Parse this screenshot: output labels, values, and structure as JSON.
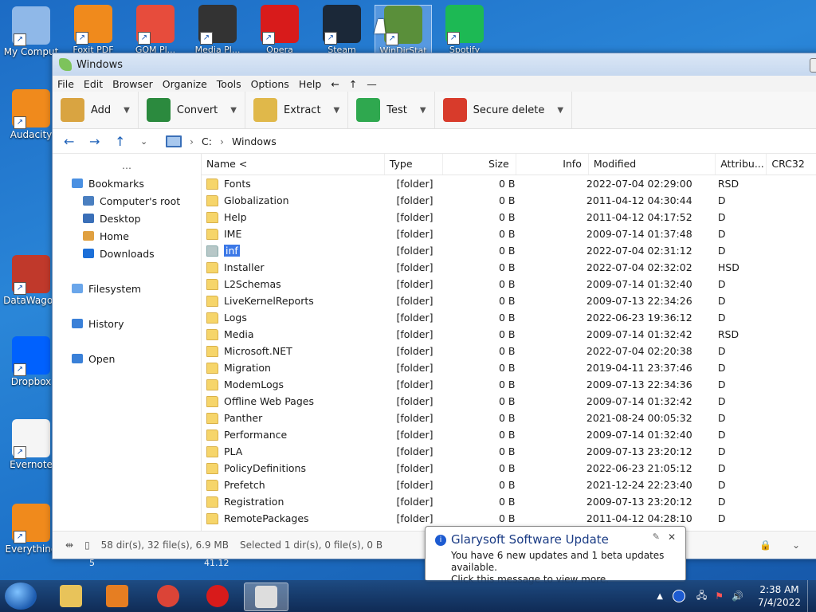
{
  "desktop": {
    "left_icons": [
      {
        "label": "My Comput",
        "color": "#8fb8e8"
      },
      {
        "label": "Audacity",
        "color": "#f08a1c"
      },
      {
        "label": "DataWagon",
        "color": "#c0392b"
      },
      {
        "label": "Dropbox",
        "color": "#0061fe"
      },
      {
        "label": "Evernote",
        "color": "#f5f5f5"
      },
      {
        "label": "Everything",
        "color": "#f08a1c"
      }
    ],
    "top_icons": [
      {
        "label": "Foxit PDF",
        "color": "#f08a1c"
      },
      {
        "label": "GOM Pl...",
        "color": "#e74c3c"
      },
      {
        "label": "Media Pl...",
        "color": "#333333"
      },
      {
        "label": "Opera",
        "color": "#d81b1b"
      },
      {
        "label": "Steam",
        "color": "#1b2838"
      },
      {
        "label": "WinDirStat",
        "color": "#5a8f3a"
      },
      {
        "label": "Spotify",
        "color": "#1db954"
      }
    ],
    "stray_texts": [
      "5",
      "41.12"
    ]
  },
  "window": {
    "title": "Windows",
    "menu": [
      "File",
      "Edit",
      "Browser",
      "Organize",
      "Tools",
      "Options",
      "Help",
      "←",
      "↑",
      "—"
    ],
    "toolbar": [
      {
        "label": "Add",
        "color": "#d9a441"
      },
      {
        "label": "Convert",
        "color": "#2b8a3e"
      },
      {
        "label": "Extract",
        "color": "#e0b84a"
      },
      {
        "label": "Test",
        "color": "#2fa84f"
      },
      {
        "label": "Secure delete",
        "color": "#d83b2b"
      }
    ],
    "address": {
      "drive": "C:",
      "folder": "Windows"
    },
    "sidebar": {
      "dots": "…",
      "items": [
        {
          "label": "Bookmarks",
          "indent": false,
          "color": "#4a90e2"
        },
        {
          "label": "Computer's root",
          "indent": true,
          "color": "#4a7fc0"
        },
        {
          "label": "Desktop",
          "indent": true,
          "color": "#3a6fb8"
        },
        {
          "label": "Home",
          "indent": true,
          "color": "#e0a040"
        },
        {
          "label": "Downloads",
          "indent": true,
          "color": "#1c6fd8"
        },
        {
          "label": "Filesystem",
          "indent": false,
          "color": "#6aa6ea"
        },
        {
          "label": "History",
          "indent": false,
          "color": "#3a80d8"
        },
        {
          "label": "Open",
          "indent": false,
          "color": "#3a80d8"
        }
      ]
    },
    "columns": [
      "Name <",
      "Type",
      "Size",
      "Info",
      "Modified",
      "Attribu...",
      "CRC32"
    ],
    "files": [
      {
        "name": "Fonts",
        "type": "[folder]",
        "size": "0 B",
        "modified": "2022-07-04 02:29:00",
        "attr": "RSD"
      },
      {
        "name": "Globalization",
        "type": "[folder]",
        "size": "0 B",
        "modified": "2011-04-12 04:30:44",
        "attr": "D"
      },
      {
        "name": "Help",
        "type": "[folder]",
        "size": "0 B",
        "modified": "2011-04-12 04:17:52",
        "attr": "D"
      },
      {
        "name": "IME",
        "type": "[folder]",
        "size": "0 B",
        "modified": "2009-07-14 01:37:48",
        "attr": "D"
      },
      {
        "name": "inf",
        "type": "[folder]",
        "size": "0 B",
        "modified": "2022-07-04 02:31:12",
        "attr": "D",
        "selected": true
      },
      {
        "name": "Installer",
        "type": "[folder]",
        "size": "0 B",
        "modified": "2022-07-04 02:32:02",
        "attr": "HSD"
      },
      {
        "name": "L2Schemas",
        "type": "[folder]",
        "size": "0 B",
        "modified": "2009-07-14 01:32:40",
        "attr": "D"
      },
      {
        "name": "LiveKernelReports",
        "type": "[folder]",
        "size": "0 B",
        "modified": "2009-07-13 22:34:26",
        "attr": "D"
      },
      {
        "name": "Logs",
        "type": "[folder]",
        "size": "0 B",
        "modified": "2022-06-23 19:36:12",
        "attr": "D"
      },
      {
        "name": "Media",
        "type": "[folder]",
        "size": "0 B",
        "modified": "2009-07-14 01:32:42",
        "attr": "RSD"
      },
      {
        "name": "Microsoft.NET",
        "type": "[folder]",
        "size": "0 B",
        "modified": "2022-07-04 02:20:38",
        "attr": "D"
      },
      {
        "name": "Migration",
        "type": "[folder]",
        "size": "0 B",
        "modified": "2019-04-11 23:37:46",
        "attr": "D"
      },
      {
        "name": "ModemLogs",
        "type": "[folder]",
        "size": "0 B",
        "modified": "2009-07-13 22:34:36",
        "attr": "D"
      },
      {
        "name": "Offline Web Pages",
        "type": "[folder]",
        "size": "0 B",
        "modified": "2009-07-14 01:32:42",
        "attr": "D"
      },
      {
        "name": "Panther",
        "type": "[folder]",
        "size": "0 B",
        "modified": "2021-08-24 00:05:32",
        "attr": "D"
      },
      {
        "name": "Performance",
        "type": "[folder]",
        "size": "0 B",
        "modified": "2009-07-14 01:32:40",
        "attr": "D"
      },
      {
        "name": "PLA",
        "type": "[folder]",
        "size": "0 B",
        "modified": "2009-07-13 23:20:12",
        "attr": "D"
      },
      {
        "name": "PolicyDefinitions",
        "type": "[folder]",
        "size": "0 B",
        "modified": "2022-06-23 21:05:12",
        "attr": "D"
      },
      {
        "name": "Prefetch",
        "type": "[folder]",
        "size": "0 B",
        "modified": "2021-12-24 22:23:40",
        "attr": "D"
      },
      {
        "name": "Registration",
        "type": "[folder]",
        "size": "0 B",
        "modified": "2009-07-13 23:20:12",
        "attr": "D"
      },
      {
        "name": "RemotePackages",
        "type": "[folder]",
        "size": "0 B",
        "modified": "2011-04-12 04:28:10",
        "attr": "D"
      }
    ],
    "status": {
      "summary": "58 dir(s), 32 file(s), 6.9 MB",
      "selection": "Selected 1 dir(s), 0 file(s), 0 B"
    }
  },
  "notification": {
    "title": "Glarysoft Software Update",
    "line1": "You have 6 new updates and 1 beta updates available.",
    "line2": "Click this message to view more."
  },
  "taskbar": {
    "apps": [
      {
        "name": "explorer",
        "color": "#e8c35a"
      },
      {
        "name": "media-player",
        "color": "#e67e22"
      },
      {
        "name": "chrome",
        "color": "#db4437"
      },
      {
        "name": "opera",
        "color": "#d81b1b"
      },
      {
        "name": "calculator",
        "color": "#dddddd"
      }
    ],
    "time": "2:38 AM",
    "date": "7/4/2022"
  }
}
